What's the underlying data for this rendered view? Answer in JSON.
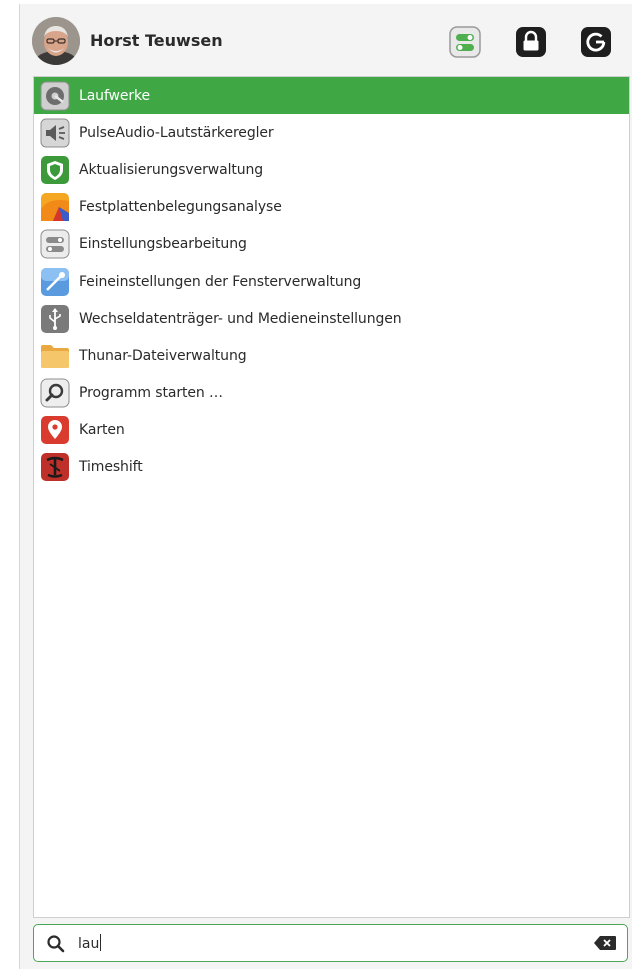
{
  "user": {
    "name": "Horst Teuwsen"
  },
  "header": {
    "buttons": [
      {
        "icon": "settings-toggle-icon"
      },
      {
        "icon": "lock-icon"
      },
      {
        "icon": "logout-icon"
      }
    ]
  },
  "results": [
    {
      "label": "Laufwerke",
      "icon": "disks-icon",
      "selected": true
    },
    {
      "label": "PulseAudio-Lautstärkeregler",
      "icon": "speaker-icon",
      "selected": false
    },
    {
      "label": "Aktualisierungsverwaltung",
      "icon": "shield-icon",
      "selected": false
    },
    {
      "label": "Festplattenbelegungsanalyse",
      "icon": "disk-usage-icon",
      "selected": false
    },
    {
      "label": "Einstellungsbearbeitung",
      "icon": "settings-editor-icon",
      "selected": false
    },
    {
      "label": "Feineinstellungen der Fensterverwaltung",
      "icon": "window-tweaks-icon",
      "selected": false
    },
    {
      "label": "Wechseldatenträger- und Medieneinstellungen",
      "icon": "usb-icon",
      "selected": false
    },
    {
      "label": "Thunar-Dateiverwaltung",
      "icon": "folder-icon",
      "selected": false
    },
    {
      "label": "Programm starten …",
      "icon": "search-run-icon",
      "selected": false
    },
    {
      "label": "Karten",
      "icon": "map-pin-icon",
      "selected": false
    },
    {
      "label": "Timeshift",
      "icon": "timeshift-icon",
      "selected": false
    }
  ],
  "search": {
    "value": "lau",
    "icon": "search-icon",
    "clear_icon": "clear-icon"
  },
  "colors": {
    "accent": "#3fa845",
    "selected_text": "#ffffff"
  }
}
